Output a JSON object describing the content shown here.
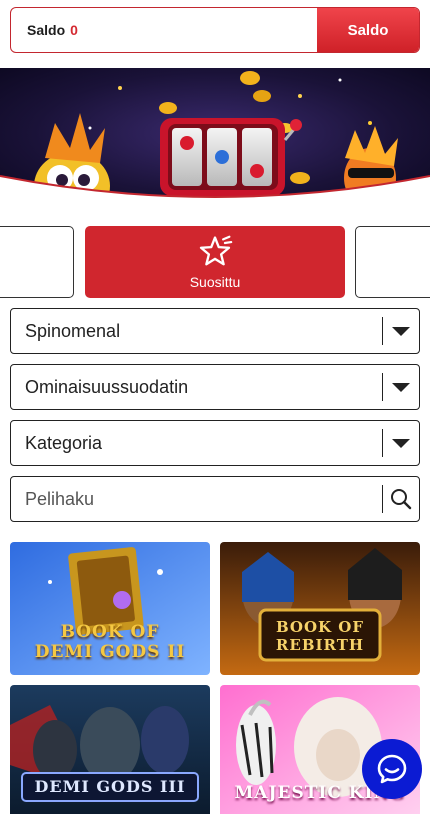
{
  "balance": {
    "label": "Saldo",
    "amount": "0",
    "button_label": "Saldo"
  },
  "banner": {
    "scene": "slot-machine-with-characters"
  },
  "categories": {
    "active_label": "Suosittu",
    "active_icon": "star-icon"
  },
  "filters": {
    "provider": "Spinomenal",
    "features": "Ominaisuussuodatin",
    "category": "Kategoria",
    "search_placeholder": "Pelihaku"
  },
  "games": [
    {
      "title_line1": "BOOK OF",
      "title_line2": "DEMI GODS II"
    },
    {
      "title_line1": "BOOK OF",
      "title_line2": "REBIRTH"
    },
    {
      "title_line1": "DEMI GODS III",
      "title_line2": ""
    },
    {
      "title_line1": "MAJESTIC KING",
      "title_line2": ""
    }
  ],
  "colors": {
    "accent": "#d0262e",
    "chat": "#0b1bd3"
  }
}
